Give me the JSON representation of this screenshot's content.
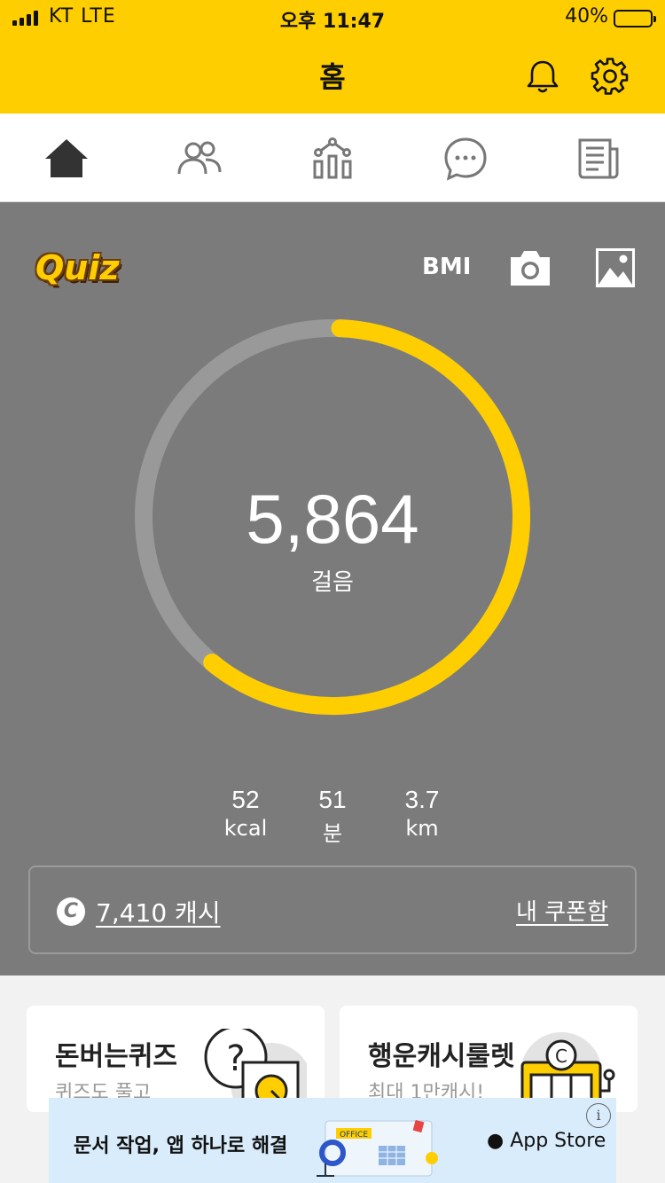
{
  "status_bar": {
    "carrier": "KT  LTE",
    "time": "오후 11:47",
    "battery": "40%"
  },
  "header": {
    "title": "홈",
    "icons": [
      "bell-icon",
      "gear-icon"
    ]
  },
  "tabs": [
    "home-icon",
    "friends-icon",
    "stats-icon",
    "chat-icon",
    "news-icon"
  ],
  "main": {
    "quiz_logo": "Quiz",
    "bmi_label": "BMI",
    "step_count": "5,864",
    "step_unit": "걸음",
    "progress_fraction": 0.61,
    "stats": [
      {
        "value": "52",
        "unit": "kcal"
      },
      {
        "value": "51",
        "unit": "분"
      },
      {
        "value": "3.7",
        "unit": "km"
      }
    ],
    "cash_icon_letter": "C",
    "cash_text": "7,410 캐시",
    "coupon_link": "내 쿠폰함"
  },
  "cards": [
    {
      "title": "돈버는퀴즈",
      "subtitle": "퀴즈도 풀고"
    },
    {
      "title": "행운캐시룰렛",
      "subtitle": "최대 1만캐시!"
    }
  ],
  "ad": {
    "text": "문서 작업, 앱 하나로 해결",
    "art_label": "OFFICE",
    "store": "App Store",
    "info": "i"
  },
  "colors": {
    "accent": "#ffce00",
    "panel": "#7b7b7b",
    "ring_track": "#999999"
  }
}
